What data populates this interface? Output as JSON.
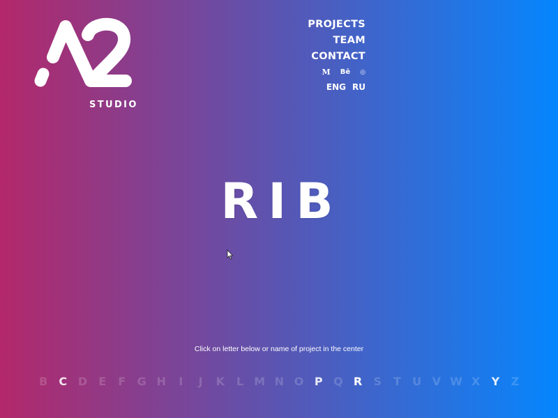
{
  "brand": {
    "logo": "A2",
    "subtitle": "STUDIO"
  },
  "nav": {
    "items": [
      {
        "label": "PROJECTS"
      },
      {
        "label": "TEAM"
      },
      {
        "label": "CONTACT"
      }
    ],
    "social": [
      {
        "icon": "medium-icon",
        "glyph": "M"
      },
      {
        "icon": "behance-icon",
        "glyph": "Bē"
      },
      {
        "icon": "dribbble-icon",
        "glyph": "◎"
      }
    ],
    "languages": [
      {
        "label": "ENG"
      },
      {
        "label": "RU"
      }
    ]
  },
  "project": {
    "name": "RIB"
  },
  "hint": "Click on letter below or name of project in the center",
  "alphabet": {
    "letters": [
      {
        "letter": "B",
        "state": "dim"
      },
      {
        "letter": "C",
        "state": "has"
      },
      {
        "letter": "D",
        "state": "dim"
      },
      {
        "letter": "E",
        "state": "dim"
      },
      {
        "letter": "F",
        "state": "dim"
      },
      {
        "letter": "G",
        "state": "dim"
      },
      {
        "letter": "H",
        "state": "dim"
      },
      {
        "letter": "I",
        "state": "dim"
      },
      {
        "letter": "J",
        "state": "dim"
      },
      {
        "letter": "K",
        "state": "dim"
      },
      {
        "letter": "L",
        "state": "dim"
      },
      {
        "letter": "M",
        "state": "dim"
      },
      {
        "letter": "N",
        "state": "dim"
      },
      {
        "letter": "O",
        "state": "dim"
      },
      {
        "letter": "P",
        "state": "has"
      },
      {
        "letter": "Q",
        "state": "dim"
      },
      {
        "letter": "R",
        "state": "active"
      },
      {
        "letter": "S",
        "state": "dim"
      },
      {
        "letter": "T",
        "state": "dim"
      },
      {
        "letter": "U",
        "state": "dim"
      },
      {
        "letter": "V",
        "state": "dim"
      },
      {
        "letter": "W",
        "state": "dim"
      },
      {
        "letter": "X",
        "state": "dim"
      },
      {
        "letter": "Y",
        "state": "has"
      },
      {
        "letter": "Z",
        "state": "dim"
      }
    ]
  },
  "colors": {
    "gradient_start": "#b3286a",
    "gradient_mid": "#5a55b2",
    "gradient_end": "#0586fe"
  }
}
